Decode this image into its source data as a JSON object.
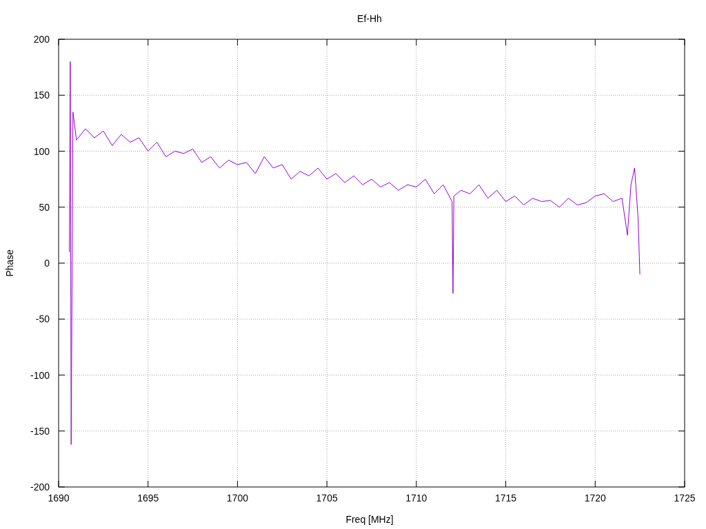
{
  "chart_data": {
    "type": "line",
    "title": "Ef-Hh",
    "xlabel": "Freq [MHz]",
    "ylabel": "Phase",
    "xlim": [
      1690,
      1725
    ],
    "ylim": [
      -200,
      200
    ],
    "xticks": [
      1690,
      1695,
      1700,
      1705,
      1710,
      1715,
      1720,
      1725
    ],
    "yticks": [
      -200,
      -150,
      -100,
      -50,
      0,
      50,
      100,
      150,
      200
    ],
    "x": [
      1690.6,
      1690.65,
      1690.7,
      1690.8,
      1691,
      1691.5,
      1692,
      1692.5,
      1693,
      1693.5,
      1694,
      1694.5,
      1695,
      1695.5,
      1696,
      1696.5,
      1697,
      1697.5,
      1698,
      1698.5,
      1699,
      1699.5,
      1700,
      1700.5,
      1701,
      1701.5,
      1702,
      1702.5,
      1703,
      1703.5,
      1704,
      1704.5,
      1705,
      1705.5,
      1706,
      1706.5,
      1707,
      1707.5,
      1708,
      1708.5,
      1709,
      1709.5,
      1710,
      1710.5,
      1711,
      1711.5,
      1712,
      1712.05,
      1712.1,
      1712.5,
      1713,
      1713.5,
      1714,
      1714.5,
      1715,
      1715.5,
      1716,
      1716.5,
      1717,
      1717.5,
      1718,
      1718.5,
      1719,
      1719.5,
      1720,
      1720.5,
      1721,
      1721.5,
      1721.8,
      1722,
      1722.2,
      1722.4,
      1722.5
    ],
    "grid": true,
    "series": [
      {
        "color": "#9400d3",
        "values": [
          10,
          180,
          -162,
          135,
          110,
          120,
          112,
          118,
          105,
          115,
          108,
          112,
          100,
          108,
          95,
          100,
          98,
          102,
          90,
          95,
          85,
          92,
          88,
          90,
          80,
          95,
          85,
          88,
          75,
          82,
          78,
          85,
          75,
          80,
          72,
          78,
          70,
          75,
          68,
          72,
          65,
          70,
          68,
          75,
          62,
          70,
          55,
          -27,
          60,
          65,
          62,
          70,
          58,
          65,
          55,
          60,
          52,
          58,
          55,
          56,
          50,
          58,
          52,
          54,
          60,
          62,
          55,
          58,
          25,
          70,
          85,
          40,
          -10
        ]
      }
    ]
  }
}
